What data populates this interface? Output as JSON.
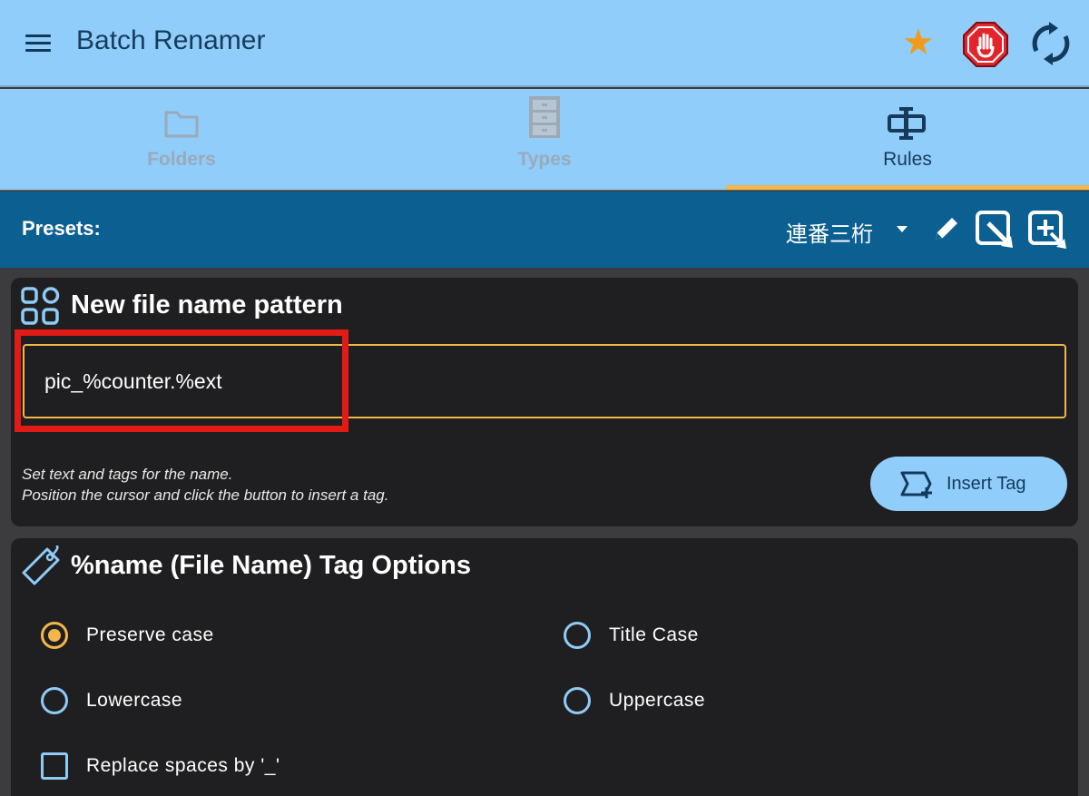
{
  "appbar": {
    "title": "Batch Renamer",
    "icons": [
      "menu-icon",
      "star-icon",
      "stop-hand-icon",
      "sync-icon"
    ],
    "accent": "#f29a1c"
  },
  "tabs": [
    {
      "label": "Folders",
      "icon": "folder-icon",
      "active": false
    },
    {
      "label": "Types",
      "icon": "cabinet-icon",
      "active": false
    },
    {
      "label": "Rules",
      "icon": "rules-icon",
      "active": true
    }
  ],
  "presets": {
    "label": "Presets:",
    "selected": "連番三桁"
  },
  "pattern_card": {
    "title": "New file name pattern",
    "value": "pic_%counter.%ext",
    "help_line1": "Set text and tags for the name.",
    "help_line2": "Position the cursor and click the button to insert a tag.",
    "insert_label": "Insert Tag"
  },
  "name_card": {
    "title": "%name (File Name) Tag Options",
    "options": [
      {
        "label": "Preserve case",
        "checked": true
      },
      {
        "label": "Title Case",
        "checked": false
      },
      {
        "label": "Lowercase",
        "checked": false
      },
      {
        "label": "Uppercase",
        "checked": false
      }
    ],
    "replace_label": "Replace spaces by '_'",
    "replace_checked": false
  },
  "colors": {
    "appbar": "#90cdfb",
    "presets_bar": "#0b5f91",
    "accent_orange": "#f2b64a",
    "highlight_red": "#e21b16",
    "card_bg": "#1f1f21"
  }
}
